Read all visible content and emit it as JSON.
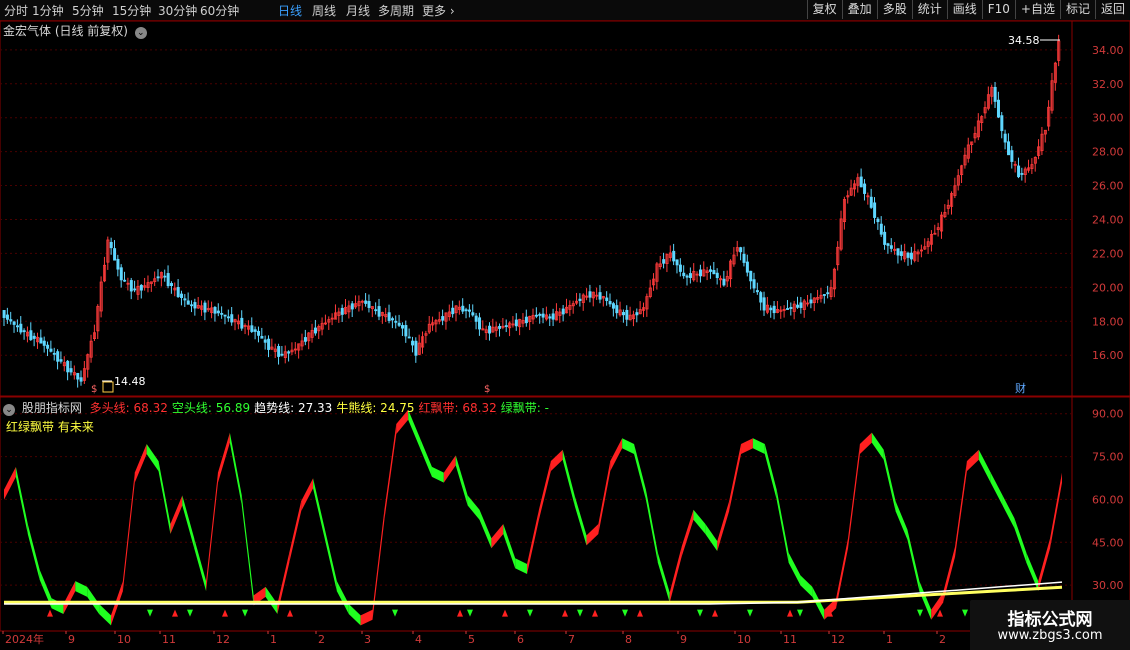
{
  "toolbar": {
    "timeframes": [
      "分时",
      "1分钟",
      "5分钟",
      "15分钟",
      "30分钟",
      "60分钟",
      "日线",
      "周线",
      "月线",
      "多周期",
      "更多"
    ],
    "active": "日线",
    "tools": [
      "复权",
      "叠加",
      "多股",
      "统计",
      "画线",
      "F10",
      "+自选",
      "标记",
      "返回"
    ]
  },
  "main_panel": {
    "title": "金宏气体 (日线 前复权)",
    "price_axis": [
      "34.00",
      "32.00",
      "30.00",
      "28.00",
      "26.00",
      "24.00",
      "22.00",
      "20.00",
      "18.00",
      "16.00"
    ],
    "high_label": "34.58",
    "low_label": "14.48",
    "fin_marker": "财",
    "colors": {
      "up": "#ff3b3b",
      "down": "#5fd7ff",
      "grid": "#5a0000"
    }
  },
  "indicator_panel": {
    "source": "股朋指标网",
    "legend": [
      {
        "label": "多头线:",
        "value": "68.32",
        "color": "#ff3030"
      },
      {
        "label": "空头线:",
        "value": "56.89",
        "color": "#30ff30"
      },
      {
        "label": "趋势线:",
        "value": "27.33",
        "color": "#ffffff"
      },
      {
        "label": "牛熊线:",
        "value": "24.75",
        "color": "#ffff40"
      },
      {
        "label": "红飘带:",
        "value": "68.32",
        "color": "#ff3030"
      },
      {
        "label": "绿飘带:",
        "value": "-",
        "color": "#30ff30"
      }
    ],
    "subtitle": "红绿飘带 有未来",
    "axis": [
      "90.00",
      "75.00",
      "60.00",
      "45.00",
      "30.00"
    ]
  },
  "date_axis": [
    "2024年",
    "9",
    "10",
    "11",
    "12",
    "1",
    "2",
    "3",
    "4",
    "5",
    "6",
    "7",
    "8",
    "9",
    "10",
    "11",
    "12",
    "1",
    "2"
  ],
  "watermark": {
    "title": "指标公式网",
    "url": "www.zbgs3.com"
  },
  "chart_data": {
    "type": "line",
    "title": "金宏气体 (日线 前复权)",
    "price_range": [
      14.48,
      34.58
    ],
    "price_series": [
      18.5,
      17.8,
      17.2,
      16.8,
      16.0,
      15.2,
      14.48,
      17.5,
      22.8,
      20.5,
      19.8,
      20.2,
      20.8,
      19.8,
      19.0,
      18.8,
      18.6,
      18.2,
      17.8,
      17.4,
      16.5,
      16.0,
      16.4,
      17.2,
      17.8,
      18.4,
      18.8,
      19.2,
      18.6,
      18.2,
      17.6,
      16.2,
      17.8,
      18.2,
      18.8,
      18.6,
      17.4,
      17.6,
      17.8,
      18.0,
      18.4,
      18.2,
      18.6,
      19.2,
      19.6,
      19.4,
      18.6,
      18.2,
      18.8,
      21.2,
      22.0,
      20.6,
      20.8,
      21.0,
      20.2,
      22.5,
      20.4,
      18.8,
      18.6,
      18.8,
      19.0,
      19.4,
      19.8,
      25.2,
      26.4,
      24.8,
      22.6,
      22.0,
      21.8,
      22.4,
      23.6,
      25.4,
      27.8,
      29.6,
      31.8,
      28.4,
      26.6,
      27.2,
      29.4,
      34.58
    ],
    "indicator_range": [
      15,
      92
    ],
    "indicator_series": [
      {
        "name": "多头线",
        "last": 68.32
      },
      {
        "name": "空头线",
        "last": 56.89
      },
      {
        "name": "趋势线",
        "last": 27.33
      },
      {
        "name": "牛熊线",
        "last": 24.75
      }
    ],
    "oscillator": [
      62,
      70,
      50,
      34,
      24,
      22,
      30,
      28,
      22,
      18,
      30,
      68,
      78,
      72,
      50,
      60,
      45,
      30,
      68,
      82,
      60,
      25,
      28,
      22,
      40,
      58,
      66,
      48,
      30,
      22,
      18,
      20,
      55,
      85,
      90,
      80,
      70,
      68,
      74,
      60,
      55,
      45,
      50,
      38,
      36,
      55,
      72,
      76,
      60,
      46,
      50,
      72,
      80,
      78,
      62,
      40,
      26,
      42,
      55,
      50,
      44,
      58,
      78,
      80,
      78,
      62,
      40,
      32,
      28,
      20,
      24,
      45,
      78,
      82,
      76,
      58,
      48,
      30,
      20,
      26,
      42,
      72,
      76,
      68,
      60,
      52,
      40,
      30,
      45,
      68
    ]
  }
}
